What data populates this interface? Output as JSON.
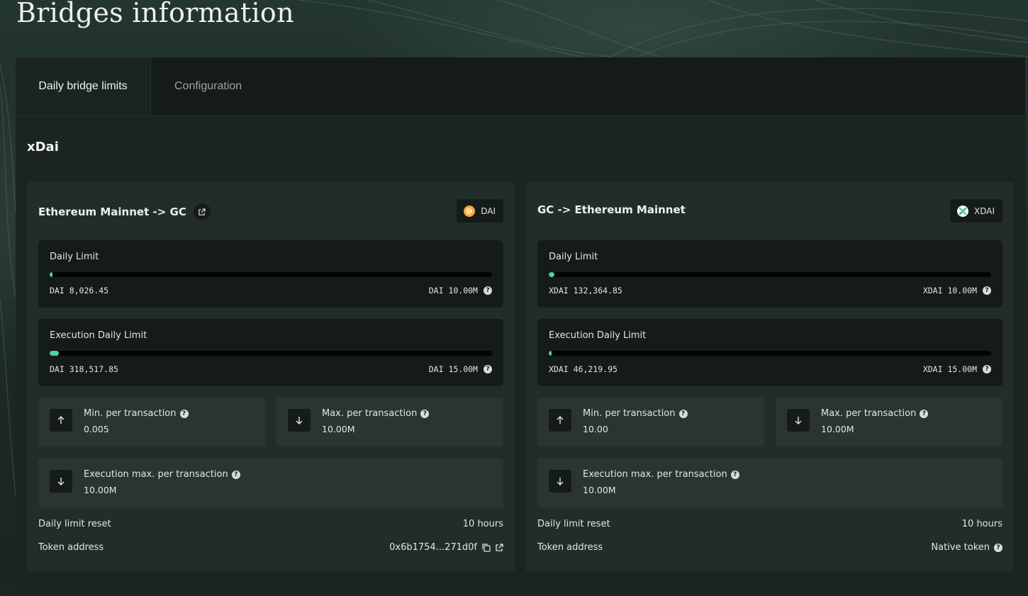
{
  "page_title": "Bridges information",
  "tabs": [
    {
      "label": "Daily bridge limits",
      "active": true
    },
    {
      "label": "Configuration",
      "active": false
    }
  ],
  "section_title": "xDai",
  "accent_color": "#4fd1a0",
  "cards": [
    {
      "title": "Ethereum Mainnet -> GC",
      "title_icon": "external-link-icon",
      "token": {
        "label": "DAI",
        "icon": "dai-coin-icon",
        "color": "#f5ac37"
      },
      "daily_limit": {
        "label": "Daily Limit",
        "current": "DAI 8,026.45",
        "max": "DAI 10.00M",
        "fill_fraction": 0.0008
      },
      "execution_daily_limit": {
        "label": "Execution Daily Limit",
        "current": "DAI 318,517.85",
        "max": "DAI 15.00M",
        "fill_fraction": 0.0212
      },
      "min_per_tx": {
        "label": "Min. per transaction",
        "value": "0.005",
        "icon": "arrow-up-icon"
      },
      "max_per_tx": {
        "label": "Max. per transaction",
        "value": "10.00M",
        "icon": "arrow-down-icon"
      },
      "exec_max_per_tx": {
        "label": "Execution max. per transaction",
        "value": "10.00M",
        "icon": "arrow-down-icon"
      },
      "reset": {
        "label": "Daily limit reset",
        "value": "10 hours"
      },
      "token_address": {
        "label": "Token address",
        "value": "0x6b1754...271d0f",
        "icons": [
          "copy-icon",
          "external-link-icon"
        ]
      }
    },
    {
      "title": "GC -> Ethereum Mainnet",
      "token": {
        "label": "XDAI",
        "icon": "xdai-coin-icon",
        "color": "#48a9a6"
      },
      "daily_limit": {
        "label": "Daily Limit",
        "current": "XDAI 132,364.85",
        "max": "XDAI 10.00M",
        "fill_fraction": 0.0132
      },
      "execution_daily_limit": {
        "label": "Execution Daily Limit",
        "current": "XDAI 46,219.95",
        "max": "XDAI 15.00M",
        "fill_fraction": 0.0031
      },
      "min_per_tx": {
        "label": "Min. per transaction",
        "value": "10.00",
        "icon": "arrow-up-icon"
      },
      "max_per_tx": {
        "label": "Max. per transaction",
        "value": "10.00M",
        "icon": "arrow-down-icon"
      },
      "exec_max_per_tx": {
        "label": "Execution max. per transaction",
        "value": "10.00M",
        "icon": "arrow-down-icon"
      },
      "reset": {
        "label": "Daily limit reset",
        "value": "10 hours"
      },
      "token_address": {
        "label": "Token address",
        "value": "Native token",
        "icons": [
          "help-icon"
        ]
      }
    }
  ]
}
